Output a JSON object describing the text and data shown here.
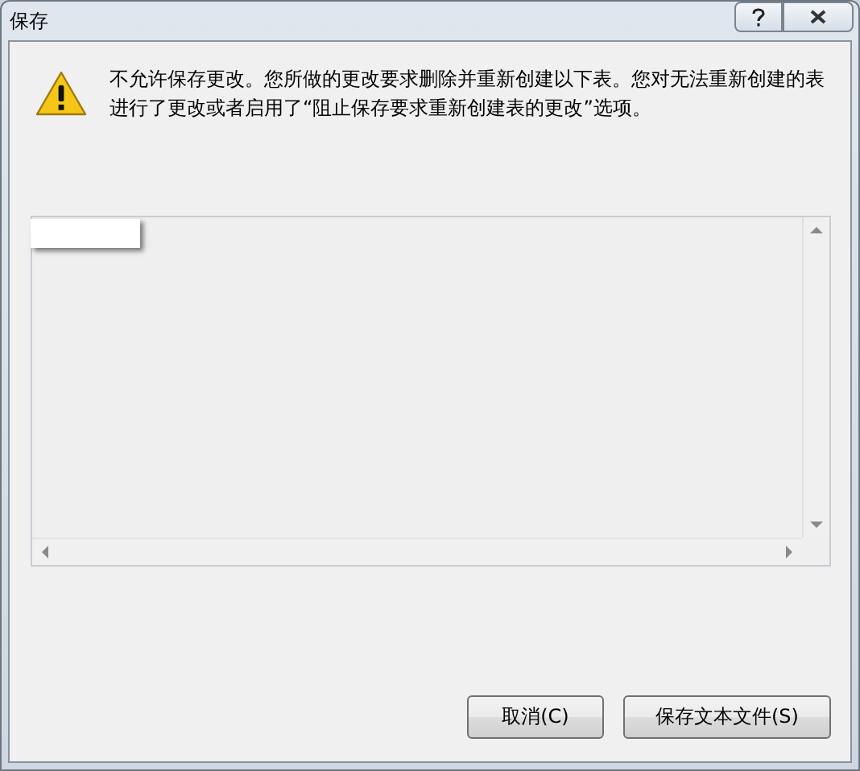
{
  "window": {
    "title": "保存"
  },
  "message": "不允许保存更改。您所做的更改要求删除并重新创建以下表。您对无法重新创建的表进行了更改或者启用了“阻止保存要求重新创建表的更改”选项。",
  "buttons": [
    {
      "label": "取消(C)"
    },
    {
      "label": "保存文本文件(S)"
    }
  ]
}
